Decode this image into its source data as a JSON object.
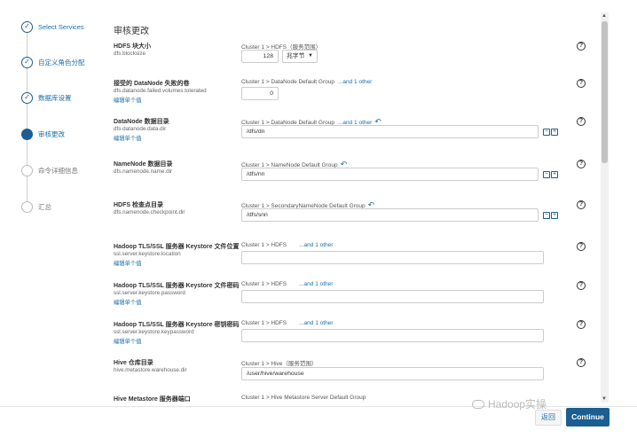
{
  "steps": [
    {
      "label": "Select Services",
      "state": "done"
    },
    {
      "label": "自定义角色分配",
      "state": "done"
    },
    {
      "label": "数据库设置",
      "state": "done"
    },
    {
      "label": "审核更改",
      "state": "current"
    },
    {
      "label": "命令详细信息",
      "state": "pending"
    },
    {
      "label": "汇总",
      "state": "pending"
    }
  ],
  "panel": {
    "title": "审核更改"
  },
  "common": {
    "help": "?",
    "edit_individual": "编辑单个值",
    "and_other": "...and 1 other",
    "undo": "↶",
    "minus": "−",
    "plus": "+"
  },
  "params": {
    "blocksize": {
      "name": "HDFS 块大小",
      "key": "dfs.blocksize",
      "scope": "Cluster 1 > HDFS（服务范围）",
      "value": "128",
      "unit": "兆字节"
    },
    "failed_volumes": {
      "name": "接受的 DataNode 失败的卷",
      "key": "dfs.datanode.failed.volumes.tolerated",
      "scope": "Cluster 1 > DataNode Default Group",
      "value": "0"
    },
    "data_dir": {
      "name": "DataNode 数据目录",
      "key": "dfs.datanode.data.dir",
      "scope": "Cluster 1 > DataNode Default Group",
      "value": "/dfs/dn"
    },
    "name_dir": {
      "name": "NameNode 数据目录",
      "key": "dfs.namenode.name.dir",
      "scope": "Cluster 1 > NameNode Default Group",
      "value": "/dfs/nn"
    },
    "checkpoint_dir": {
      "name": "HDFS 检查点目录",
      "key": "dfs.namenode.checkpoint.dir",
      "scope": "Cluster 1 > SecondaryNameNode Default Group",
      "value": "/dfs/snn"
    },
    "keystore_location": {
      "name": "Hadoop TLS/SSL 服务器 Keystore 文件位置",
      "key": "ssl.server.keystore.location",
      "scope": "Cluster 1 > HDFS",
      "value": ""
    },
    "keystore_password": {
      "name": "Hadoop TLS/SSL 服务器 Keystore 文件密码",
      "key": "ssl.server.keystore.password",
      "scope": "Cluster 1 > HDFS",
      "value": ""
    },
    "keystore_keypassword": {
      "name": "Hadoop TLS/SSL 服务器 Keystore 密钥密码",
      "key": "ssl.server.keystore.keypassword",
      "scope": "Cluster 1 > HDFS",
      "value": ""
    },
    "hive_warehouse": {
      "name": "Hive 仓库目录",
      "key": "hive.metastore.warehouse.dir",
      "scope": "Cluster 1 > Hive（服务范围）",
      "value": "/user/hive/warehouse"
    },
    "hive_metastore_port": {
      "name": "Hive Metastore 服务器端口",
      "scope": "Cluster 1 > Hive Metastore Server Default Group"
    }
  },
  "scrollbar": {
    "up": "▲",
    "down": "▼"
  },
  "watermark": "Hadoop实操",
  "footer": {
    "back": "返回",
    "continue": "Continue"
  },
  "colors": {
    "accent": "#1a5e92",
    "link": "#1a6fa8"
  }
}
